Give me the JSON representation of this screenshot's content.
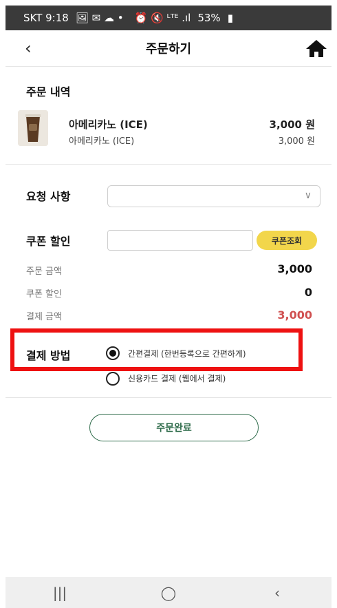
{
  "status_bar": {
    "carrier_time": "SKT 9:18",
    "icons": "🖼 ✉ ☁ •",
    "right_icons": "⏰ 🔇 ᴸᵀᴱ .ıl",
    "battery": "53%"
  },
  "header": {
    "back_icon": "‹",
    "title": "주문하기",
    "home_icon": "home-icon"
  },
  "order": {
    "section_title": "주문 내역",
    "item": {
      "name": "아메리카노 (ICE)",
      "sub": "아메리카노 (ICE)",
      "price": "3,000 원",
      "price_sub": "3,000 원"
    }
  },
  "request": {
    "label": "요청 사항",
    "value": "",
    "chevron": "∨"
  },
  "coupon": {
    "label": "쿠폰 할인",
    "input_value": "",
    "input_placeholder": "",
    "button_label": "쿠폰조회"
  },
  "summary": {
    "order_amount_label": "주문 금액",
    "order_amount": "3,000",
    "coupon_label": "쿠폰 할인",
    "coupon_value": "0",
    "payment_label": "결제 금액",
    "payment_amount": "3,000"
  },
  "payment": {
    "label": "결제 방법",
    "options": [
      {
        "label": "간편결제 (한번등록으로 간편하게)",
        "selected": true
      },
      {
        "label": "신용카드 결제 (웹에서 결제)",
        "selected": false
      }
    ]
  },
  "complete_button": "주문완료",
  "nav": {
    "recent": "|||",
    "home": "◯",
    "back": "‹"
  },
  "colors": {
    "highlight_box": "#ee1111",
    "coupon_button": "#f2d64b",
    "complete_accent": "#2e6b4a",
    "payment_amount": "#d05050"
  }
}
